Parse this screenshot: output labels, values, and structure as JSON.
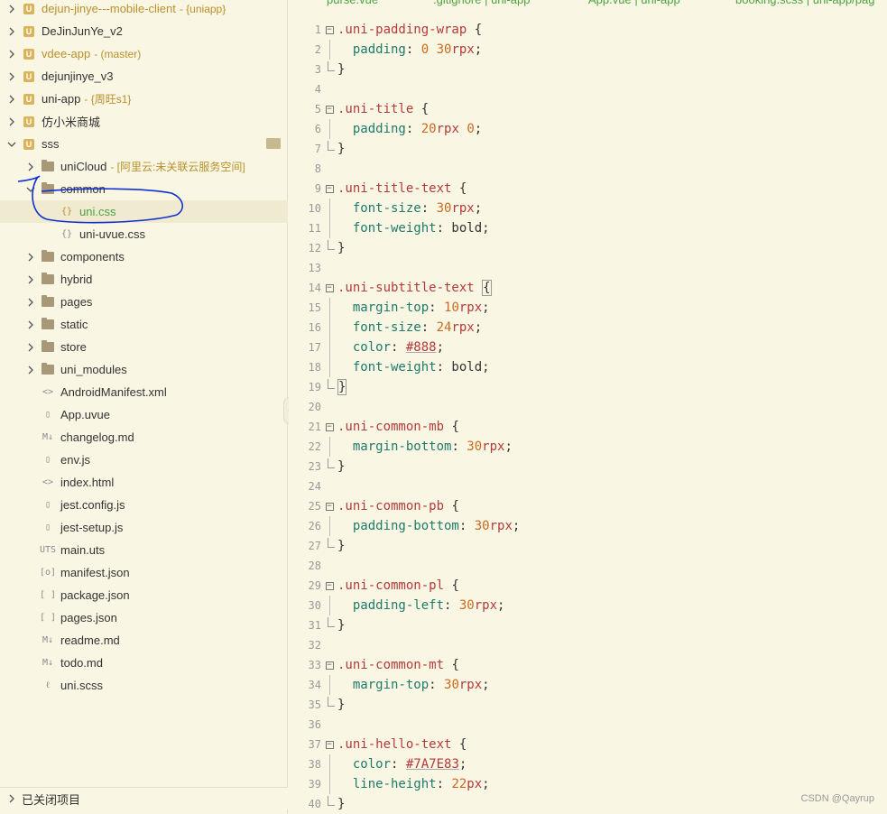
{
  "sidebar": {
    "rows": [
      {
        "label": "dejun-jinye---mobile-client",
        "tag": "{uniapp}",
        "style": "gold",
        "icon": "project-icon",
        "chev": "right",
        "indent": 0
      },
      {
        "label": "DeJinJunYe_v2",
        "tag": "",
        "style": "",
        "icon": "project-icon",
        "chev": "right",
        "indent": 0
      },
      {
        "label": "vdee-app",
        "tag": "(master)",
        "style": "gold",
        "icon": "project-icon",
        "chev": "right",
        "indent": 0
      },
      {
        "label": "dejunjinye_v3",
        "tag": "",
        "style": "",
        "icon": "project-icon",
        "chev": "right",
        "indent": 0
      },
      {
        "label": "uni-app",
        "tag": "{周旺s1}",
        "style": "",
        "icon": "project-icon",
        "chev": "right",
        "indent": 0
      },
      {
        "label": "仿小米商城",
        "tag": "",
        "style": "",
        "icon": "project-icon",
        "chev": "right",
        "indent": 0
      },
      {
        "label": "sss",
        "tag": "",
        "style": "",
        "icon": "project-icon",
        "chev": "down",
        "indent": 0
      },
      {
        "label": "uniCloud",
        "tag": "- [阿里云:未关联云服务空间]",
        "style": "",
        "icon": "folder-icon",
        "chev": "right",
        "indent": 1
      },
      {
        "label": "common",
        "tag": "",
        "style": "",
        "icon": "folder-icon",
        "chev": "down",
        "indent": 1
      },
      {
        "label": "uni.css",
        "tag": "",
        "style": "green",
        "icon": "css-file-icon",
        "chev": "",
        "indent": 2,
        "selected": true
      },
      {
        "label": "uni-uvue.css",
        "tag": "",
        "style": "",
        "icon": "css-file-icon",
        "chev": "",
        "indent": 2
      },
      {
        "label": "components",
        "tag": "",
        "style": "",
        "icon": "folder-icon",
        "chev": "right",
        "indent": 1
      },
      {
        "label": "hybrid",
        "tag": "",
        "style": "",
        "icon": "folder-icon",
        "chev": "right",
        "indent": 1
      },
      {
        "label": "pages",
        "tag": "",
        "style": "",
        "icon": "folder-icon",
        "chev": "right",
        "indent": 1
      },
      {
        "label": "static",
        "tag": "",
        "style": "",
        "icon": "folder-icon",
        "chev": "right",
        "indent": 1
      },
      {
        "label": "store",
        "tag": "",
        "style": "",
        "icon": "folder-icon",
        "chev": "right",
        "indent": 1
      },
      {
        "label": "uni_modules",
        "tag": "",
        "style": "",
        "icon": "folder-icon",
        "chev": "right",
        "indent": 1
      },
      {
        "label": "AndroidManifest.xml",
        "tag": "",
        "style": "",
        "icon": "xml-file-icon",
        "chev": "",
        "indent": 1
      },
      {
        "label": "App.uvue",
        "tag": "",
        "style": "",
        "icon": "vue-file-icon",
        "chev": "",
        "indent": 1
      },
      {
        "label": "changelog.md",
        "tag": "",
        "style": "",
        "icon": "markdown-file-icon",
        "chev": "",
        "indent": 1
      },
      {
        "label": "env.js",
        "tag": "",
        "style": "",
        "icon": "js-file-icon",
        "chev": "",
        "indent": 1
      },
      {
        "label": "index.html",
        "tag": "",
        "style": "",
        "icon": "html-file-icon",
        "chev": "",
        "indent": 1
      },
      {
        "label": "jest.config.js",
        "tag": "",
        "style": "",
        "icon": "js-file-icon",
        "chev": "",
        "indent": 1
      },
      {
        "label": "jest-setup.js",
        "tag": "",
        "style": "",
        "icon": "js-file-icon",
        "chev": "",
        "indent": 1
      },
      {
        "label": "main.uts",
        "tag": "",
        "style": "",
        "icon": "uts-file-icon",
        "chev": "",
        "indent": 1
      },
      {
        "label": "manifest.json",
        "tag": "",
        "style": "",
        "icon": "manifest-file-icon",
        "chev": "",
        "indent": 1
      },
      {
        "label": "package.json",
        "tag": "",
        "style": "",
        "icon": "json-file-icon",
        "chev": "",
        "indent": 1
      },
      {
        "label": "pages.json",
        "tag": "",
        "style": "",
        "icon": "json-file-icon",
        "chev": "",
        "indent": 1
      },
      {
        "label": "readme.md",
        "tag": "",
        "style": "",
        "icon": "markdown-file-icon",
        "chev": "",
        "indent": 1
      },
      {
        "label": "todo.md",
        "tag": "",
        "style": "",
        "icon": "markdown-file-icon",
        "chev": "",
        "indent": 1
      },
      {
        "label": "uni.scss",
        "tag": "",
        "style": "",
        "icon": "scss-file-icon",
        "chev": "",
        "indent": 1
      }
    ],
    "closed_projects_label": "已关闭项目"
  },
  "icons": {
    "project-icon": "U",
    "css-file-icon": "{}",
    "xml-file-icon": "<>",
    "html-file-icon": "<>",
    "vue-file-icon": "▯",
    "markdown-file-icon": "M↓",
    "js-file-icon": "▯",
    "uts-file-icon": "UTS",
    "manifest-file-icon": "[o]",
    "json-file-icon": "[ ]",
    "scss-file-icon": "ℓ"
  },
  "tabs": [
    {
      "label": "purse.vue"
    },
    {
      "label": ".gitignore | uni-app"
    },
    {
      "label": "App.vue | uni-app"
    },
    {
      "label": "booking.scss | uni-app/pag"
    }
  ],
  "code": [
    {
      "n": "1",
      "fold": "open",
      "tokens": [
        [
          "sel",
          ".uni-padding-wrap"
        ],
        [
          "pun",
          " {"
        ]
      ]
    },
    {
      "n": "2",
      "fold": "line",
      "tokens": [
        [
          "pun",
          "  "
        ],
        [
          "prop",
          "padding"
        ],
        [
          "pun",
          ": "
        ],
        [
          "num",
          "0"
        ],
        [
          "pun",
          " "
        ],
        [
          "num",
          "30"
        ],
        [
          "unit",
          "rpx"
        ],
        [
          "pun",
          ";"
        ]
      ]
    },
    {
      "n": "3",
      "fold": "end",
      "tokens": [
        [
          "pun",
          "}"
        ]
      ]
    },
    {
      "n": "4",
      "fold": "",
      "tokens": []
    },
    {
      "n": "5",
      "fold": "open",
      "tokens": [
        [
          "sel",
          ".uni-title"
        ],
        [
          "pun",
          " {"
        ]
      ]
    },
    {
      "n": "6",
      "fold": "line",
      "tokens": [
        [
          "pun",
          "  "
        ],
        [
          "prop",
          "padding"
        ],
        [
          "pun",
          ": "
        ],
        [
          "num",
          "20"
        ],
        [
          "unit",
          "rpx"
        ],
        [
          "pun",
          " "
        ],
        [
          "num",
          "0"
        ],
        [
          "pun",
          ";"
        ]
      ]
    },
    {
      "n": "7",
      "fold": "end",
      "tokens": [
        [
          "pun",
          "}"
        ]
      ]
    },
    {
      "n": "8",
      "fold": "",
      "tokens": []
    },
    {
      "n": "9",
      "fold": "open",
      "tokens": [
        [
          "sel",
          ".uni-title-text"
        ],
        [
          "pun",
          " {"
        ]
      ]
    },
    {
      "n": "10",
      "fold": "line",
      "tokens": [
        [
          "pun",
          "  "
        ],
        [
          "prop",
          "font-size"
        ],
        [
          "pun",
          ": "
        ],
        [
          "num",
          "30"
        ],
        [
          "unit",
          "rpx"
        ],
        [
          "pun",
          ";"
        ]
      ]
    },
    {
      "n": "11",
      "fold": "line",
      "tokens": [
        [
          "pun",
          "  "
        ],
        [
          "prop",
          "font-weight"
        ],
        [
          "pun",
          ": bold;"
        ]
      ]
    },
    {
      "n": "12",
      "fold": "end",
      "tokens": [
        [
          "pun",
          "}"
        ]
      ]
    },
    {
      "n": "13",
      "fold": "",
      "tokens": []
    },
    {
      "n": "14",
      "fold": "open",
      "tokens": [
        [
          "sel",
          ".uni-subtitle-text"
        ],
        [
          "pun",
          " "
        ],
        [
          "brk",
          "{"
        ]
      ]
    },
    {
      "n": "15",
      "fold": "line",
      "tokens": [
        [
          "pun",
          "  "
        ],
        [
          "prop",
          "margin-top"
        ],
        [
          "pun",
          ": "
        ],
        [
          "num",
          "10"
        ],
        [
          "unit",
          "rpx"
        ],
        [
          "pun",
          ";"
        ]
      ]
    },
    {
      "n": "16",
      "fold": "line",
      "tokens": [
        [
          "pun",
          "  "
        ],
        [
          "prop",
          "font-size"
        ],
        [
          "pun",
          ": "
        ],
        [
          "num",
          "24"
        ],
        [
          "unit",
          "rpx"
        ],
        [
          "pun",
          ";"
        ]
      ]
    },
    {
      "n": "17",
      "fold": "line",
      "tokens": [
        [
          "pun",
          "  "
        ],
        [
          "prop",
          "color"
        ],
        [
          "pun",
          ": "
        ],
        [
          "hex",
          "#888"
        ],
        [
          "pun",
          ";"
        ]
      ]
    },
    {
      "n": "18",
      "fold": "line",
      "tokens": [
        [
          "pun",
          "  "
        ],
        [
          "prop",
          "font-weight"
        ],
        [
          "pun",
          ": bold;"
        ]
      ]
    },
    {
      "n": "19",
      "fold": "end",
      "tokens": [
        [
          "brk",
          "}"
        ]
      ]
    },
    {
      "n": "20",
      "fold": "",
      "tokens": []
    },
    {
      "n": "21",
      "fold": "open",
      "tokens": [
        [
          "sel",
          ".uni-common-mb"
        ],
        [
          "pun",
          " {"
        ]
      ]
    },
    {
      "n": "22",
      "fold": "line",
      "tokens": [
        [
          "pun",
          "  "
        ],
        [
          "prop",
          "margin-bottom"
        ],
        [
          "pun",
          ": "
        ],
        [
          "num",
          "30"
        ],
        [
          "unit",
          "rpx"
        ],
        [
          "pun",
          ";"
        ]
      ]
    },
    {
      "n": "23",
      "fold": "end",
      "tokens": [
        [
          "pun",
          "}"
        ]
      ]
    },
    {
      "n": "24",
      "fold": "",
      "tokens": []
    },
    {
      "n": "25",
      "fold": "open",
      "tokens": [
        [
          "sel",
          ".uni-common-pb"
        ],
        [
          "pun",
          " {"
        ]
      ]
    },
    {
      "n": "26",
      "fold": "line",
      "tokens": [
        [
          "pun",
          "  "
        ],
        [
          "prop",
          "padding-bottom"
        ],
        [
          "pun",
          ": "
        ],
        [
          "num",
          "30"
        ],
        [
          "unit",
          "rpx"
        ],
        [
          "pun",
          ";"
        ]
      ]
    },
    {
      "n": "27",
      "fold": "end",
      "tokens": [
        [
          "pun",
          "}"
        ]
      ]
    },
    {
      "n": "28",
      "fold": "",
      "tokens": []
    },
    {
      "n": "29",
      "fold": "open",
      "tokens": [
        [
          "sel",
          ".uni-common-pl"
        ],
        [
          "pun",
          " {"
        ]
      ]
    },
    {
      "n": "30",
      "fold": "line",
      "tokens": [
        [
          "pun",
          "  "
        ],
        [
          "prop",
          "padding-left"
        ],
        [
          "pun",
          ": "
        ],
        [
          "num",
          "30"
        ],
        [
          "unit",
          "rpx"
        ],
        [
          "pun",
          ";"
        ]
      ]
    },
    {
      "n": "31",
      "fold": "end",
      "tokens": [
        [
          "pun",
          "}"
        ]
      ]
    },
    {
      "n": "32",
      "fold": "",
      "tokens": []
    },
    {
      "n": "33",
      "fold": "open",
      "tokens": [
        [
          "sel",
          ".uni-common-mt"
        ],
        [
          "pun",
          " {"
        ]
      ]
    },
    {
      "n": "34",
      "fold": "line",
      "tokens": [
        [
          "pun",
          "  "
        ],
        [
          "prop",
          "margin-top"
        ],
        [
          "pun",
          ": "
        ],
        [
          "num",
          "30"
        ],
        [
          "unit",
          "rpx"
        ],
        [
          "pun",
          ";"
        ]
      ]
    },
    {
      "n": "35",
      "fold": "end",
      "tokens": [
        [
          "pun",
          "}"
        ]
      ]
    },
    {
      "n": "36",
      "fold": "",
      "tokens": []
    },
    {
      "n": "37",
      "fold": "open",
      "tokens": [
        [
          "sel",
          ".uni-hello-text"
        ],
        [
          "pun",
          " {"
        ]
      ]
    },
    {
      "n": "38",
      "fold": "line",
      "tokens": [
        [
          "pun",
          "  "
        ],
        [
          "prop",
          "color"
        ],
        [
          "pun",
          ": "
        ],
        [
          "hex",
          "#7A7E83"
        ],
        [
          "pun",
          ";"
        ]
      ]
    },
    {
      "n": "39",
      "fold": "line",
      "tokens": [
        [
          "pun",
          "  "
        ],
        [
          "prop",
          "line-height"
        ],
        [
          "pun",
          ": "
        ],
        [
          "num",
          "22"
        ],
        [
          "unit",
          "px"
        ],
        [
          "pun",
          ";"
        ]
      ]
    },
    {
      "n": "40",
      "fold": "end",
      "tokens": [
        [
          "pun",
          "}"
        ]
      ]
    }
  ],
  "watermark": "CSDN @Qayrup",
  "colors": {
    "background": "#FAF6E4",
    "selector": "#B53A3A",
    "property": "#1E7A6B",
    "number": "#C96A1E",
    "active_file": "#4CA33F",
    "annotation": "#1030D0"
  }
}
